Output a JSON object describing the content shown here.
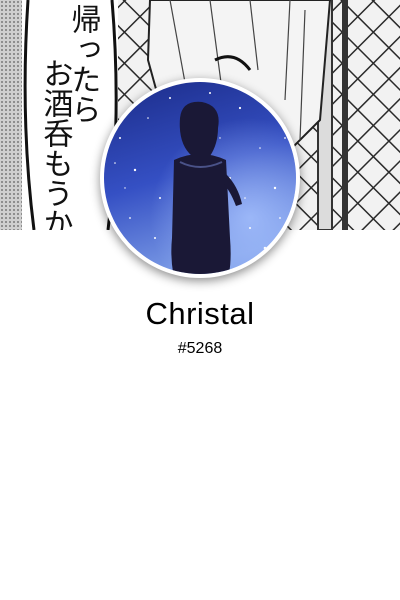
{
  "profile": {
    "banner": {
      "description_icon": "manga-banner-image",
      "speech_line_1": "帰ったら",
      "speech_line_2": "お酒呑もうか"
    },
    "avatar": {
      "icon": "avatar-image"
    },
    "username": "Christal",
    "discriminator": "#5268"
  },
  "colors": {
    "background": "#ffffff",
    "avatar_sky_top": "#1c2f8f",
    "avatar_sky_bottom": "#6d8fe0",
    "text": "#000000"
  }
}
